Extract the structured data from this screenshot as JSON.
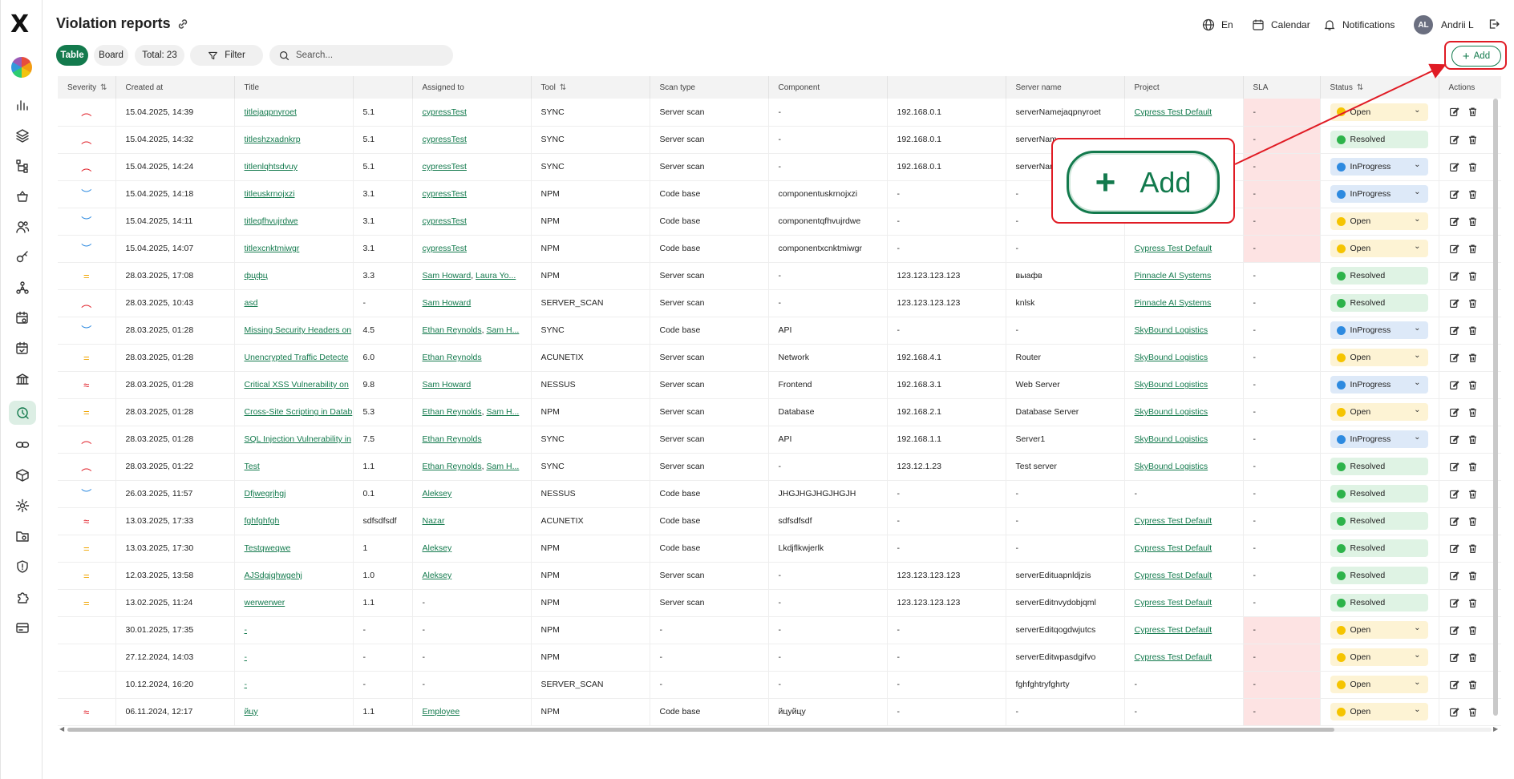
{
  "app": {
    "logo_letter": "X"
  },
  "header": {
    "title": "Violation reports",
    "language": "En",
    "calendar": "Calendar",
    "notifications": "Notifications",
    "user_initials": "AL",
    "user_name": "Andrii L"
  },
  "toolbar": {
    "table_label": "Table",
    "board_label": "Board",
    "total_label": "Total: 23",
    "filter_label": "Filter",
    "search_placeholder": "Search...",
    "add_label": "Add",
    "add_plus": "+"
  },
  "callout": {
    "label": "Add",
    "plus": "+"
  },
  "columns": [
    "Severity",
    "Created at",
    "Title",
    "",
    "Assigned to",
    "Tool",
    "Scan type",
    "Component",
    "",
    "Server name",
    "Project",
    "SLA",
    "Status",
    "Actions"
  ],
  "rows": [
    {
      "sev": "high1",
      "date": "15.04.2025, 14:39",
      "title": "titlejaqpnyroet",
      "score": "5.1",
      "assigned": [
        "cypressTest"
      ],
      "tool": "SYNC",
      "scan": "Server scan",
      "component": "-",
      "ip": "192.168.0.1",
      "server": "serverNamejaqpnyroet",
      "project": "Cypress Test Default",
      "sla": "-",
      "sla_red": true,
      "status": "Open"
    },
    {
      "sev": "high1",
      "date": "15.04.2025, 14:32",
      "title": "titleshzxadnkrp",
      "score": "5.1",
      "assigned": [
        "cypressTest"
      ],
      "tool": "SYNC",
      "scan": "Server scan",
      "component": "-",
      "ip": "192.168.0.1",
      "server": "serverNam",
      "project": "",
      "sla": "-",
      "sla_red": true,
      "status": "Resolved"
    },
    {
      "sev": "high1",
      "date": "15.04.2025, 14:24",
      "title": "titlenlqhtsdvuy",
      "score": "5.1",
      "assigned": [
        "cypressTest"
      ],
      "tool": "SYNC",
      "scan": "Server scan",
      "component": "-",
      "ip": "192.168.0.1",
      "server": "serverNam",
      "project": "",
      "sla": "-",
      "sla_red": true,
      "status": "InProgress"
    },
    {
      "sev": "low",
      "date": "15.04.2025, 14:18",
      "title": "titleuskrnojxzi",
      "score": "3.1",
      "assigned": [
        "cypressTest"
      ],
      "tool": "NPM",
      "scan": "Code base",
      "component": "componentuskrnojxzi",
      "ip": "-",
      "server": "-",
      "project": "",
      "sla": "-",
      "sla_red": true,
      "status": "InProgress"
    },
    {
      "sev": "low",
      "date": "15.04.2025, 14:11",
      "title": "titleqfhvujrdwe",
      "score": "3.1",
      "assigned": [
        "cypressTest"
      ],
      "tool": "NPM",
      "scan": "Code base",
      "component": "componentqfhvujrdwe",
      "ip": "-",
      "server": "-",
      "project": "",
      "sla": "-",
      "sla_red": true,
      "status": "Open"
    },
    {
      "sev": "low",
      "date": "15.04.2025, 14:07",
      "title": "titlexcnktmiwgr",
      "score": "3.1",
      "assigned": [
        "cypressTest"
      ],
      "tool": "NPM",
      "scan": "Code base",
      "component": "componentxcnktmiwgr",
      "ip": "-",
      "server": "-",
      "project": "Cypress Test Default",
      "sla": "-",
      "sla_red": true,
      "status": "Open"
    },
    {
      "sev": "med",
      "date": "28.03.2025, 17:08",
      "title": "фцфц",
      "score": "3.3",
      "assigned": [
        "Sam Howard",
        "Laura Yo..."
      ],
      "tool": "NPM",
      "scan": "Server scan",
      "component": "-",
      "ip": "123.123.123.123",
      "server": "выафв",
      "project": "Pinnacle AI Systems",
      "sla": "-",
      "sla_red": false,
      "status": "Resolved"
    },
    {
      "sev": "high1",
      "date": "28.03.2025, 10:43",
      "title": "asd",
      "score": "-",
      "assigned": [
        "Sam Howard"
      ],
      "tool": "SERVER_SCAN",
      "scan": "Server scan",
      "component": "-",
      "ip": "123.123.123.123",
      "server": "knlsk",
      "project": "Pinnacle AI Systems",
      "sla": "-",
      "sla_red": false,
      "status": "Resolved"
    },
    {
      "sev": "low",
      "date": "28.03.2025, 01:28",
      "title": "Missing Security Headers on",
      "score": "4.5",
      "assigned": [
        "Ethan Reynolds",
        "Sam H..."
      ],
      "tool": "SYNC",
      "scan": "Code base",
      "component": "API",
      "ip": "-",
      "server": "-",
      "project": "SkyBound Logistics",
      "sla": "-",
      "sla_red": false,
      "status": "InProgress"
    },
    {
      "sev": "med",
      "date": "28.03.2025, 01:28",
      "title": "Unencrypted Traffic Detecte",
      "score": "6.0",
      "assigned": [
        "Ethan Reynolds"
      ],
      "tool": "ACUNETIX",
      "scan": "Server scan",
      "component": "Network",
      "ip": "192.168.4.1",
      "server": "Router",
      "project": "SkyBound Logistics",
      "sla": "-",
      "sla_red": false,
      "status": "Open"
    },
    {
      "sev": "high2",
      "date": "28.03.2025, 01:28",
      "title": "Critical XSS Vulnerability on",
      "score": "9.8",
      "assigned": [
        "Sam Howard"
      ],
      "tool": "NESSUS",
      "scan": "Server scan",
      "component": "Frontend",
      "ip": "192.168.3.1",
      "server": "Web Server",
      "project": "SkyBound Logistics",
      "sla": "-",
      "sla_red": false,
      "status": "InProgress"
    },
    {
      "sev": "med",
      "date": "28.03.2025, 01:28",
      "title": "Cross-Site Scripting in Datab",
      "score": "5.3",
      "assigned": [
        "Ethan Reynolds",
        "Sam H..."
      ],
      "tool": "NPM",
      "scan": "Server scan",
      "component": "Database",
      "ip": "192.168.2.1",
      "server": "Database Server",
      "project": "SkyBound Logistics",
      "sla": "-",
      "sla_red": false,
      "status": "Open"
    },
    {
      "sev": "high1",
      "date": "28.03.2025, 01:28",
      "title": "SQL Injection Vulnerability in",
      "score": "7.5",
      "assigned": [
        "Ethan Reynolds"
      ],
      "tool": "SYNC",
      "scan": "Server scan",
      "component": "API",
      "ip": "192.168.1.1",
      "server": "Server1",
      "project": "SkyBound Logistics",
      "sla": "-",
      "sla_red": false,
      "status": "InProgress"
    },
    {
      "sev": "high1",
      "date": "28.03.2025, 01:22",
      "title": "Test",
      "score": "1.1",
      "assigned": [
        "Ethan Reynolds",
        "Sam H..."
      ],
      "tool": "SYNC",
      "scan": "Server scan",
      "component": "-",
      "ip": "123.12.1.23",
      "server": "Test server",
      "project": "SkyBound Logistics",
      "sla": "-",
      "sla_red": false,
      "status": "Resolved"
    },
    {
      "sev": "low",
      "date": "26.03.2025, 11:57",
      "title": "Dfjwegrjhgj",
      "score": "0.1",
      "assigned": [
        "Aleksey"
      ],
      "tool": "NESSUS",
      "scan": "Code base",
      "component": "JHGJHGJHGJHGJH",
      "ip": "-",
      "server": "-",
      "project": "-",
      "sla": "-",
      "sla_red": false,
      "status": "Resolved"
    },
    {
      "sev": "high2",
      "date": "13.03.2025, 17:33",
      "title": "fghfghfgh",
      "score": "sdfsdfsdf",
      "assigned": [
        "Nazar"
      ],
      "tool": "ACUNETIX",
      "scan": "Code base",
      "component": "sdfsdfsdf",
      "ip": "-",
      "server": "-",
      "project": "Cypress Test Default",
      "sla": "-",
      "sla_red": false,
      "status": "Resolved"
    },
    {
      "sev": "med",
      "date": "13.03.2025, 17:30",
      "title": "Testqweqwe",
      "score": "1",
      "assigned": [
        "Aleksey"
      ],
      "tool": "NPM",
      "scan": "Code base",
      "component": "Lkdjflkwjerlk",
      "ip": "-",
      "server": "-",
      "project": "Cypress Test Default",
      "sla": "-",
      "sla_red": false,
      "status": "Resolved"
    },
    {
      "sev": "med",
      "date": "12.03.2025, 13:58",
      "title": "AJSdgjqhwgehj",
      "score": "1.0",
      "assigned": [
        "Aleksey"
      ],
      "tool": "NPM",
      "scan": "Server scan",
      "component": "-",
      "ip": "123.123.123.123",
      "server": "serverEdituapnldjzis",
      "project": "Cypress Test Default",
      "sla": "-",
      "sla_red": false,
      "status": "Resolved"
    },
    {
      "sev": "med",
      "date": "13.02.2025, 11:24",
      "title": "werwerwer",
      "score": "1.1",
      "assigned": [],
      "tool": "NPM",
      "scan": "Server scan",
      "component": "-",
      "ip": "123.123.123.123",
      "server": "serverEditnvydobjqml",
      "project": "Cypress Test Default",
      "sla": "-",
      "sla_red": false,
      "status": "Resolved"
    },
    {
      "sev": "none",
      "date": "30.01.2025, 17:35",
      "title": "-",
      "score": "-",
      "assigned": [],
      "tool": "NPM",
      "scan": "-",
      "component": "-",
      "ip": "-",
      "server": "serverEditqogdwjutcs",
      "project": "Cypress Test Default",
      "sla": "-",
      "sla_red": true,
      "status": "Open"
    },
    {
      "sev": "none",
      "date": "27.12.2024, 14:03",
      "title": "-",
      "score": "-",
      "assigned": [],
      "tool": "NPM",
      "scan": "-",
      "component": "-",
      "ip": "-",
      "server": "serverEditwpasdgifvo",
      "project": "Cypress Test Default",
      "sla": "-",
      "sla_red": true,
      "status": "Open"
    },
    {
      "sev": "none",
      "date": "10.12.2024, 16:20",
      "title": "-",
      "score": "-",
      "assigned": [],
      "tool": "SERVER_SCAN",
      "scan": "-",
      "component": "-",
      "ip": "-",
      "server": "fghfghtryfghrty",
      "project": "-",
      "sla": "-",
      "sla_red": true,
      "status": "Open"
    },
    {
      "sev": "high2",
      "date": "06.11.2024, 12:17",
      "title": "йцу",
      "score": "1.1",
      "assigned": [
        "Employee"
      ],
      "tool": "NPM",
      "scan": "Code base",
      "component": "йцуйцу",
      "ip": "-",
      "server": "-",
      "project": "-",
      "sla": "-",
      "sla_red": true,
      "status": "Open"
    }
  ],
  "colors": {
    "accent": "#137a4d",
    "annotation": "#e01b24",
    "open": "#f5c400",
    "resolved": "#2db34a",
    "in_progress": "#2d8ae0"
  },
  "sidebar_icons": [
    "bar-chart-icon",
    "layers-icon",
    "tree-icon",
    "basket-icon",
    "users-icon",
    "key-icon",
    "network-icon",
    "calendar-settings-icon",
    "calendar-check-icon",
    "bank-icon",
    "violations-icon",
    "link-icon",
    "cube-icon",
    "gear-icon",
    "folder-icon",
    "shield-icon",
    "puzzle-icon",
    "card-icon"
  ]
}
